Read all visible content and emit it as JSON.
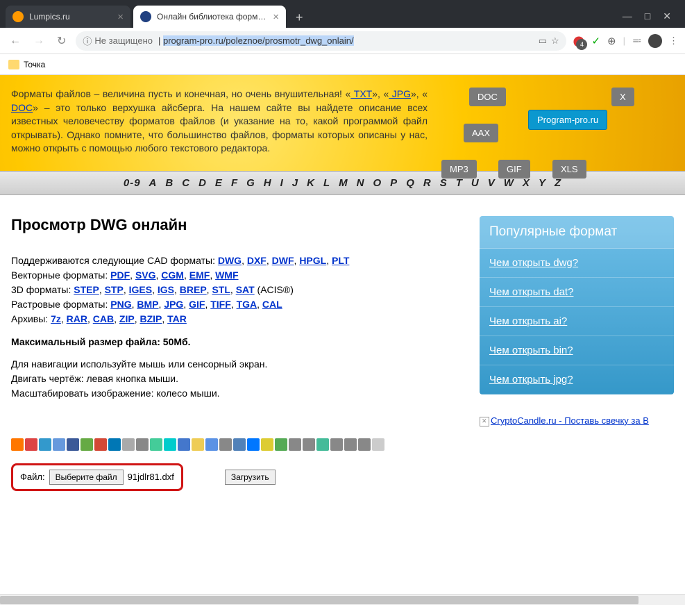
{
  "tabs": [
    {
      "title": "Lumpics.ru",
      "active": false,
      "favicon": "#ff9900"
    },
    {
      "title": "Онлайн библиотека форматов",
      "active": true,
      "favicon": "#204080"
    }
  ],
  "window": {
    "minimize": "—",
    "maximize": "□",
    "close": "✕",
    "newtab": "+"
  },
  "nav": {
    "back": "←",
    "forward": "→",
    "reload": "↻"
  },
  "url": {
    "info": "ⓘ",
    "security": "Не защищено",
    "prefix": "",
    "selected": "program-pro.ru/poleznoe/prosmotr_dwg_onlain/",
    "suffix": "",
    "reader": "▭",
    "star": "☆"
  },
  "ext_badge": "4",
  "bookmarks": {
    "folder1": "Точка"
  },
  "banner": {
    "text1": "Форматы файлов – величина пусть и конечная, но очень внушительная! «",
    "link1": " TXT",
    "text2": "», «",
    "link2": " JPG",
    "text3": "», «",
    "link3": " DOC",
    "text4": "» – это только верхушка айсберга. На нашем сайте вы найдете описание всех известных человечеству форматов файлов (и указание на то, какой программой файл открывать). Однако помните, что большинство файлов, форматы которых описаны у нас, можно открыть с помощью любого текстового редактора."
  },
  "diagram": {
    "doc": "DOC",
    "aax": "AAX",
    "mp3": "MP3",
    "gif": "GIF",
    "xls": "XLS",
    "center": "Program-pro.ru",
    "x": "X"
  },
  "alpha": [
    "0-9",
    "A",
    "B",
    "C",
    "D",
    "E",
    "F",
    "G",
    "H",
    "I",
    "J",
    "K",
    "L",
    "M",
    "N",
    "O",
    "P",
    "Q",
    "R",
    "S",
    "T",
    "U",
    "V",
    "W",
    "X",
    "Y",
    "Z"
  ],
  "page_title": "Просмотр DWG онлайн",
  "formats": {
    "cad_label": "Поддерживаются следующие CAD форматы: ",
    "cad": [
      "DWG",
      "DXF",
      "DWF",
      "HPGL",
      "PLT"
    ],
    "vec_label": "Векторные форматы: ",
    "vec": [
      "PDF",
      "SVG",
      "CGM",
      "EMF",
      "WMF"
    ],
    "d3_label": "3D форматы: ",
    "d3": [
      "STEP",
      "STP",
      "IGES",
      "IGS",
      "BREP",
      "STL",
      "SAT"
    ],
    "d3_suffix": " (ACIS®)",
    "rast_label": "Растровые форматы: ",
    "rast": [
      "PNG",
      "BMP",
      "JPG",
      "GIF",
      "TIFF",
      "TGA",
      "CAL"
    ],
    "arch_label": "Архивы: ",
    "arch": [
      "7z",
      "RAR",
      "CAB",
      "ZIP",
      "BZIP",
      "TAR"
    ]
  },
  "max_size": "Максимальный размер файла: 50Мб.",
  "navhint1": "Для навигации используйте мышь или сенсорный экран.",
  "navhint2": "Двигать чертёж: левая кнопка мыши.",
  "navhint3": "Масштабировать изображение: колесо мыши.",
  "file": {
    "label": "Файл:",
    "choose": "Выберите файл",
    "name": "91jdlr81.dxf",
    "upload": "Загрузить"
  },
  "sidebar": {
    "title": "Популярные формат",
    "links": [
      "Чем открыть dwg?",
      "Чем открыть dat?",
      "Чем открыть ai?",
      "Чем открыть bin?",
      "Чем открыть jpg?"
    ],
    "bottom": "CryptoCandle.ru - Поставь свечку за B"
  },
  "social_colors": [
    "#ff7700",
    "#d44",
    "#39c",
    "#69d",
    "#3b5998",
    "#6a4",
    "#d34836",
    "#0077b5",
    "#aaa",
    "#888",
    "#4c9",
    "#0cc",
    "#47c",
    "#ec5",
    "#5b92e5",
    "#888",
    "#5181b8",
    "#07f",
    "#dc3",
    "#5a5",
    "#888",
    "#888",
    "#4b9",
    "#888",
    "#888",
    "#888",
    "#ccc"
  ]
}
